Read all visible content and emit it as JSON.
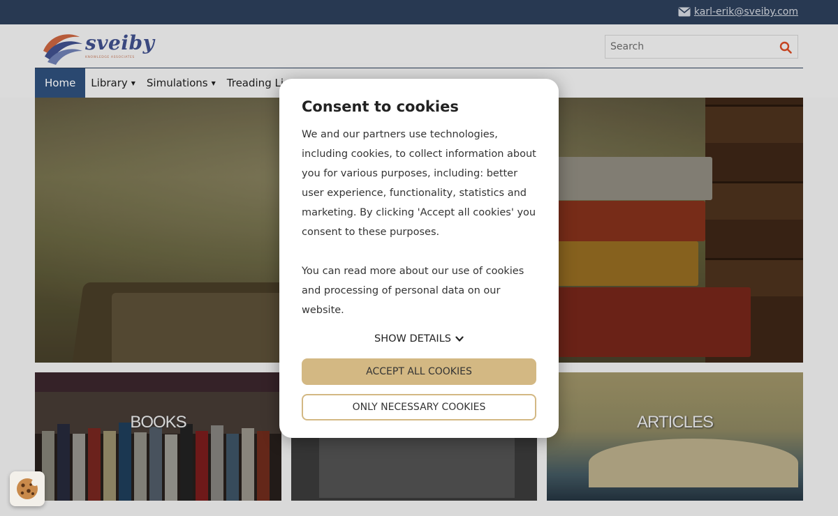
{
  "topbar": {
    "email": "karl-erik@sveiby.com"
  },
  "header": {
    "logo_text": "sveiby",
    "logo_tagline": "KNOWLEDGE ASSOCIATES",
    "search_placeholder": "Search"
  },
  "nav": {
    "items": [
      {
        "label": "Home",
        "active": true
      },
      {
        "label": "Library",
        "dropdown": true
      },
      {
        "label": "Simulations",
        "dropdown": true
      },
      {
        "label": "Treading Lig",
        "dropdown": false
      }
    ]
  },
  "tiles": [
    {
      "label": "BOOKS"
    },
    {
      "label": ""
    },
    {
      "label": "ARTICLES"
    }
  ],
  "consent": {
    "title": "Consent to cookies",
    "paragraph1": "We and our partners use technologies, including cookies, to collect information about you for various purposes, including: better user experience, functionality, statistics and marketing. By clicking 'Accept all cookies' you consent to these purposes.",
    "paragraph2": "You can read more about our use of cookies and processing of personal data on our website.",
    "show_details": "SHOW DETAILS",
    "accept_all": "ACCEPT ALL COOKIES",
    "only_necessary": "ONLY NECESSARY COOKIES"
  },
  "colors": {
    "topbar": "#2c3e5a",
    "nav_active": "#2e4f7a",
    "accent_button": "#d3b883"
  },
  "icons": {
    "mail": "mail-icon",
    "search": "search-icon",
    "chevron": "chevron-down-icon",
    "cookie": "cookie-icon"
  }
}
